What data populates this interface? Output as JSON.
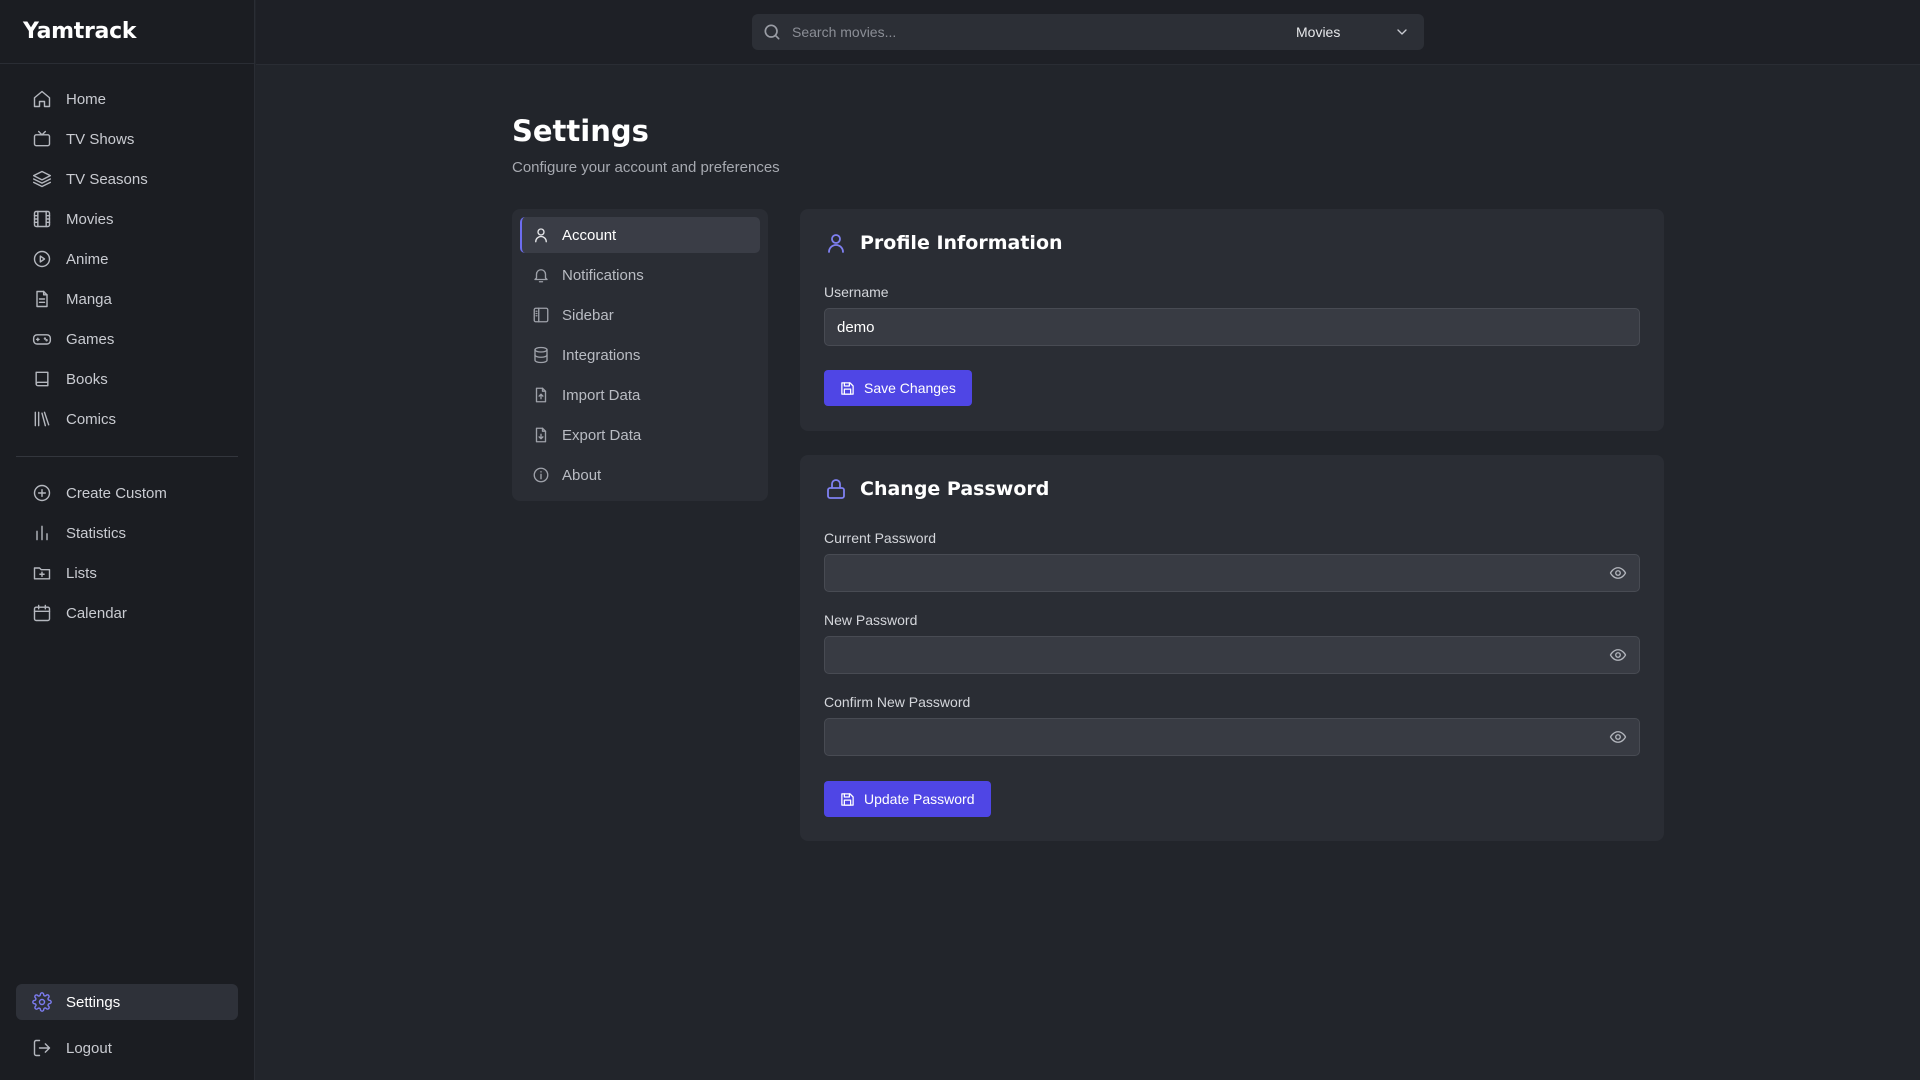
{
  "app": {
    "name": "Yamtrack"
  },
  "search": {
    "placeholder": "Search movies...",
    "value": "",
    "media_type": "Movies"
  },
  "sidebar": {
    "items": [
      {
        "label": "Home",
        "icon": "home-icon"
      },
      {
        "label": "TV Shows",
        "icon": "tv-icon"
      },
      {
        "label": "TV Seasons",
        "icon": "layers-icon"
      },
      {
        "label": "Movies",
        "icon": "film-icon"
      },
      {
        "label": "Anime",
        "icon": "play-circle-icon"
      },
      {
        "label": "Manga",
        "icon": "document-icon"
      },
      {
        "label": "Games",
        "icon": "gamepad-icon"
      },
      {
        "label": "Books",
        "icon": "book-icon"
      },
      {
        "label": "Comics",
        "icon": "library-icon"
      }
    ],
    "secondary": [
      {
        "label": "Create Custom",
        "icon": "plus-circle-icon"
      },
      {
        "label": "Statistics",
        "icon": "bar-chart-icon"
      },
      {
        "label": "Lists",
        "icon": "folder-plus-icon"
      },
      {
        "label": "Calendar",
        "icon": "calendar-icon"
      }
    ],
    "bottom": [
      {
        "label": "Settings",
        "icon": "gear-icon",
        "active": true
      },
      {
        "label": "Logout",
        "icon": "logout-icon"
      }
    ]
  },
  "page": {
    "title": "Settings",
    "subtitle": "Configure your account and preferences"
  },
  "settings_nav": [
    {
      "label": "Account",
      "icon": "user-icon",
      "active": true
    },
    {
      "label": "Notifications",
      "icon": "bell-icon"
    },
    {
      "label": "Sidebar",
      "icon": "sidebar-icon"
    },
    {
      "label": "Integrations",
      "icon": "database-icon"
    },
    {
      "label": "Import Data",
      "icon": "file-import-icon"
    },
    {
      "label": "Export Data",
      "icon": "file-export-icon"
    },
    {
      "label": "About",
      "icon": "info-icon"
    }
  ],
  "profile": {
    "title": "Profile Information",
    "username_label": "Username",
    "username_value": "demo",
    "save_label": "Save Changes"
  },
  "password": {
    "title": "Change Password",
    "current_label": "Current Password",
    "new_label": "New Password",
    "confirm_label": "Confirm New Password",
    "update_label": "Update Password"
  },
  "colors": {
    "accent": "#4f46e5",
    "accent_icon": "#7f80f2",
    "background": "#22252b",
    "sidebar": "#1b1d22",
    "card": "#2a2d34"
  }
}
